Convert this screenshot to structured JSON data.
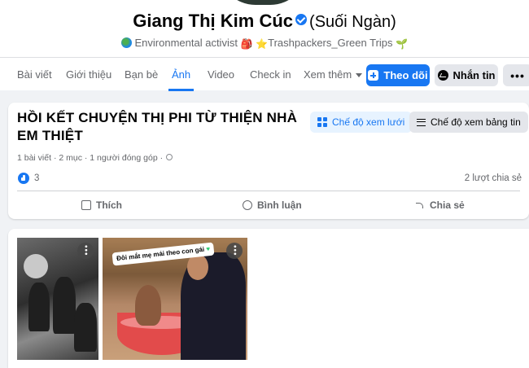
{
  "profile": {
    "name": "Giang Thị Kim Cúc",
    "alt_name": "(Suối Ngàn)",
    "bio_role": "Environmental activist",
    "bio_group": "Trashpackers_Green Trips"
  },
  "tabs": [
    {
      "label": "Bài viết"
    },
    {
      "label": "Giới thiệu"
    },
    {
      "label": "Bạn bè"
    },
    {
      "label": "Ảnh",
      "active": true
    },
    {
      "label": "Video"
    },
    {
      "label": "Check in"
    },
    {
      "label": "Xem thêm"
    }
  ],
  "actions": {
    "follow": "Theo dõi",
    "message": "Nhắn tin",
    "more": "•••"
  },
  "album": {
    "title": "HỒI KẾT CHUYỆN THỊ PHI TỪ THIỆN NHÀ EM THIỆT",
    "grid_view": "Chế độ xem lưới",
    "feed_view": "Chế độ xem bảng tin",
    "meta": "1 bài viết · 2 mục · 1 người đóng góp ·",
    "reactions": "3",
    "shares": "2 lượt chia sẻ",
    "like": "Thích",
    "comment": "Bình luận",
    "share": "Chia sẻ"
  },
  "photos": [
    {
      "caption": ""
    },
    {
      "caption": "Đôi mắt mẹ mải theo con gái"
    }
  ],
  "colors": {
    "accent": "#1877f2",
    "background": "#f0f2f5"
  }
}
